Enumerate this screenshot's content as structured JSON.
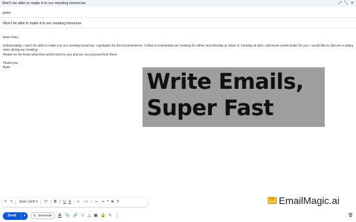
{
  "window": {
    "title": "Won't be able to make it to our meeting tomorrow",
    "controls": [
      "⤢",
      "⤡",
      "✕"
    ]
  },
  "compose": {
    "to": "peter",
    "subject": "Won't be able to make it to our meeting tomorrow",
    "greeting": "Dear Peter,",
    "paragraph_line1": "Unfortunately, I won't be able to make it to our meeting tomorrow. I apologize for the inconvenience. I'd like to reschedule our meeting for either next Monday at 10am or Tuesday at 4pm, whichever works better for you. I would like to discuss a salary raise during our meeting.",
    "paragraph_line2": "Please let me know what time works best for you and we can proceed from there.",
    "signoff": "Thank you,",
    "signature": "Ryan"
  },
  "promo": {
    "line1": "Write Emails,",
    "line2": "Super Fast"
  },
  "brand": {
    "name": "EmailMagic.ai",
    "icon": "envelope-icon"
  },
  "format_toolbar": {
    "undo": "↶",
    "redo": "↷",
    "font": "Sans Serif",
    "font_caret": "▾",
    "size": "ᴛT",
    "bold": "B",
    "italic": "I",
    "underline": "U",
    "text_color": "A",
    "align": "≡",
    "numbered_list": "⋮≡",
    "bulleted_list": "∷",
    "indent_less": "⇤",
    "indent_more": "⇥",
    "quote": "❝",
    "strikethrough": "S",
    "clear_format": "T̸"
  },
  "bottom_bar": {
    "send_label": "Send",
    "send_more": "▾",
    "generate_label": "Generate",
    "icons": {
      "format_text": "A",
      "attach": "📎",
      "link": "🔗",
      "emoji": "☺",
      "drive": "△",
      "photo": "▣",
      "lock": "🔒",
      "signature": "✎",
      "more": "⋮",
      "trash": "🗑"
    }
  },
  "colors": {
    "send_blue": "#0b57d0",
    "promo_gray": "#9e9e9e",
    "titlebar_bg": "#f1f4f9"
  }
}
